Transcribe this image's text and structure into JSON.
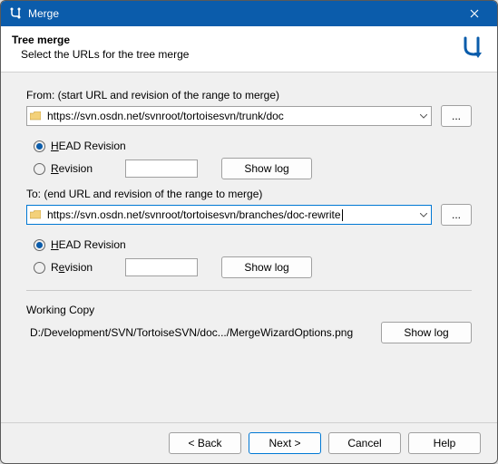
{
  "window": {
    "title": "Merge"
  },
  "header": {
    "title": "Tree merge",
    "subtitle": "Select the URLs for the tree merge"
  },
  "from": {
    "label": "From: (start URL and revision of the range to merge)",
    "url": "https://svn.osdn.net/svnroot/tortoisesvn/trunk/doc",
    "browse": "...",
    "head_label": "HEAD Revision",
    "rev_label": "Revision",
    "rev_value": "",
    "showlog": "Show log",
    "head_selected": true
  },
  "to": {
    "label": "To: (end URL and revision of the range to merge)",
    "url": "https://svn.osdn.net/svnroot/tortoisesvn/branches/doc-rewrite",
    "browse": "...",
    "head_label": "HEAD Revision",
    "rev_label": "Revision",
    "rev_value": "",
    "showlog": "Show log",
    "head_selected": true
  },
  "wc": {
    "label": "Working Copy",
    "path": "D:/Development/SVN/TortoiseSVN/doc.../MergeWizardOptions.png",
    "showlog": "Show log"
  },
  "footer": {
    "back": "< Back",
    "next": "Next >",
    "cancel": "Cancel",
    "help": "Help"
  }
}
